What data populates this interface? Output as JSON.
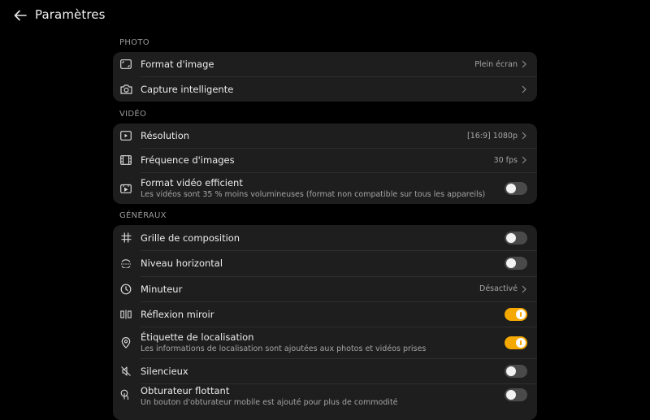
{
  "header": {
    "title": "Paramètres",
    "back_icon": "arrow-left-icon"
  },
  "sections": {
    "photo": {
      "label": "PHOTO",
      "rows": [
        {
          "label": "Format d'image",
          "value": "Plein écran",
          "icon": "aspect-ratio-icon"
        },
        {
          "label": "Capture intelligente",
          "value": "",
          "icon": "camera-icon"
        }
      ]
    },
    "video": {
      "label": "VIDÉO",
      "rows": [
        {
          "label": "Résolution",
          "value": "[16:9] 1080p",
          "icon": "video-resolution-icon"
        },
        {
          "label": "Fréquence d'images",
          "value": "30 fps",
          "icon": "film-icon"
        },
        {
          "label": "Format vidéo efficient",
          "sub": "Les vidéos sont 35 % moins volumineuses (format non compatible sur tous les appareils)",
          "icon": "efficient-video-icon",
          "toggle": false
        }
      ]
    },
    "general": {
      "label": "GÉNÉRAUX",
      "rows": [
        {
          "label": "Grille de composition",
          "icon": "grid-icon",
          "toggle": false
        },
        {
          "label": "Niveau horizontal",
          "icon": "level-icon",
          "toggle": false
        },
        {
          "label": "Minuteur",
          "value": "Désactivé",
          "icon": "timer-icon"
        },
        {
          "label": "Réflexion miroir",
          "icon": "mirror-icon",
          "toggle": true
        },
        {
          "label": "Étiquette de localisation",
          "sub": "Les informations de localisation sont ajoutées aux photos et vidéos prises",
          "icon": "location-pin-icon",
          "toggle": true
        },
        {
          "label": "Silencieux",
          "icon": "mute-icon",
          "toggle": false
        },
        {
          "label": "Obturateur flottant",
          "sub": "Un bouton d'obturateur mobile est ajouté pour plus de commodité",
          "icon": "floating-shutter-icon",
          "toggle": false
        }
      ]
    }
  },
  "colors": {
    "accent": "#f5a800",
    "card": "#1e1e1e",
    "background": "#000000"
  }
}
